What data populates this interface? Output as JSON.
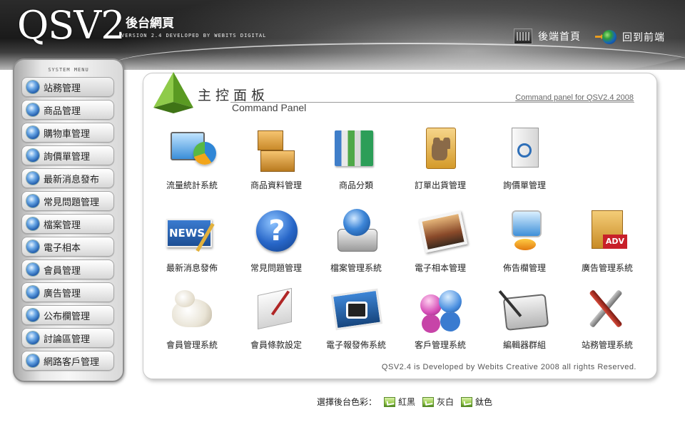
{
  "header": {
    "logo": "QSV2",
    "subtitle": "後台網頁",
    "version": "VERSION 2.4 DEVELOPED BY WEBITS DIGITAL",
    "links": [
      {
        "label": "後端首頁",
        "icon": "film-icon"
      },
      {
        "label": "回到前端",
        "icon": "globe-arrow-icon"
      }
    ]
  },
  "sidebar": {
    "title": "SYSTEM MENU",
    "items": [
      {
        "label": "站務管理"
      },
      {
        "label": "商品管理"
      },
      {
        "label": "購物車管理"
      },
      {
        "label": "詢價單管理"
      },
      {
        "label": "最新消息發布"
      },
      {
        "label": "常見問題管理"
      },
      {
        "label": "檔案管理"
      },
      {
        "label": "電子相本"
      },
      {
        "label": "會員管理"
      },
      {
        "label": "廣告管理"
      },
      {
        "label": "公布欄管理"
      },
      {
        "label": "討論區管理"
      },
      {
        "label": "網路客戶管理"
      }
    ]
  },
  "panel": {
    "title_zh": "主控面板",
    "title_en": "Command Panel",
    "caption": "Command panel for QSV2.4 2008",
    "footer": "QSV2.4 is Developed by Webits Creative 2008 all rights Reserved.",
    "tiles": [
      {
        "label": "流量統計系統",
        "icon": "stats-chart-icon"
      },
      {
        "label": "商品資料管理",
        "icon": "boxes-icon"
      },
      {
        "label": "商品分類",
        "icon": "books-icon"
      },
      {
        "label": "訂單出貨管理",
        "icon": "folder-mule-icon"
      },
      {
        "label": "詢價單管理",
        "icon": "document-search-icon"
      },
      {
        "label": "最新消息發佈",
        "icon": "news-icon"
      },
      {
        "label": "常見問題管理",
        "icon": "help-icon"
      },
      {
        "label": "檔案管理系統",
        "icon": "drive-icon"
      },
      {
        "label": "電子相本管理",
        "icon": "photo-icon"
      },
      {
        "label": "佈告欄管理",
        "icon": "computer-icon"
      },
      {
        "label": "廣告管理系統",
        "icon": "adv-folder-icon"
      },
      {
        "label": "會員管理系統",
        "icon": "polar-bear-icon"
      },
      {
        "label": "會員條款設定",
        "icon": "scroll-icon"
      },
      {
        "label": "電子報發佈系統",
        "icon": "newsletter-icon"
      },
      {
        "label": "客戶管理系統",
        "icon": "people-icon"
      },
      {
        "label": "編輯器群組",
        "icon": "tablet-pen-icon"
      },
      {
        "label": "站務管理系統",
        "icon": "tools-icon"
      }
    ]
  },
  "theme": {
    "label": "選擇後台色彩：",
    "options": [
      {
        "label": "紅黑"
      },
      {
        "label": "灰白"
      },
      {
        "label": "鈦色"
      }
    ]
  },
  "colors": {
    "header_dark": "#1a1a1a",
    "accent_green": "#7ab83a",
    "bullet_blue": "#1d58a8"
  }
}
